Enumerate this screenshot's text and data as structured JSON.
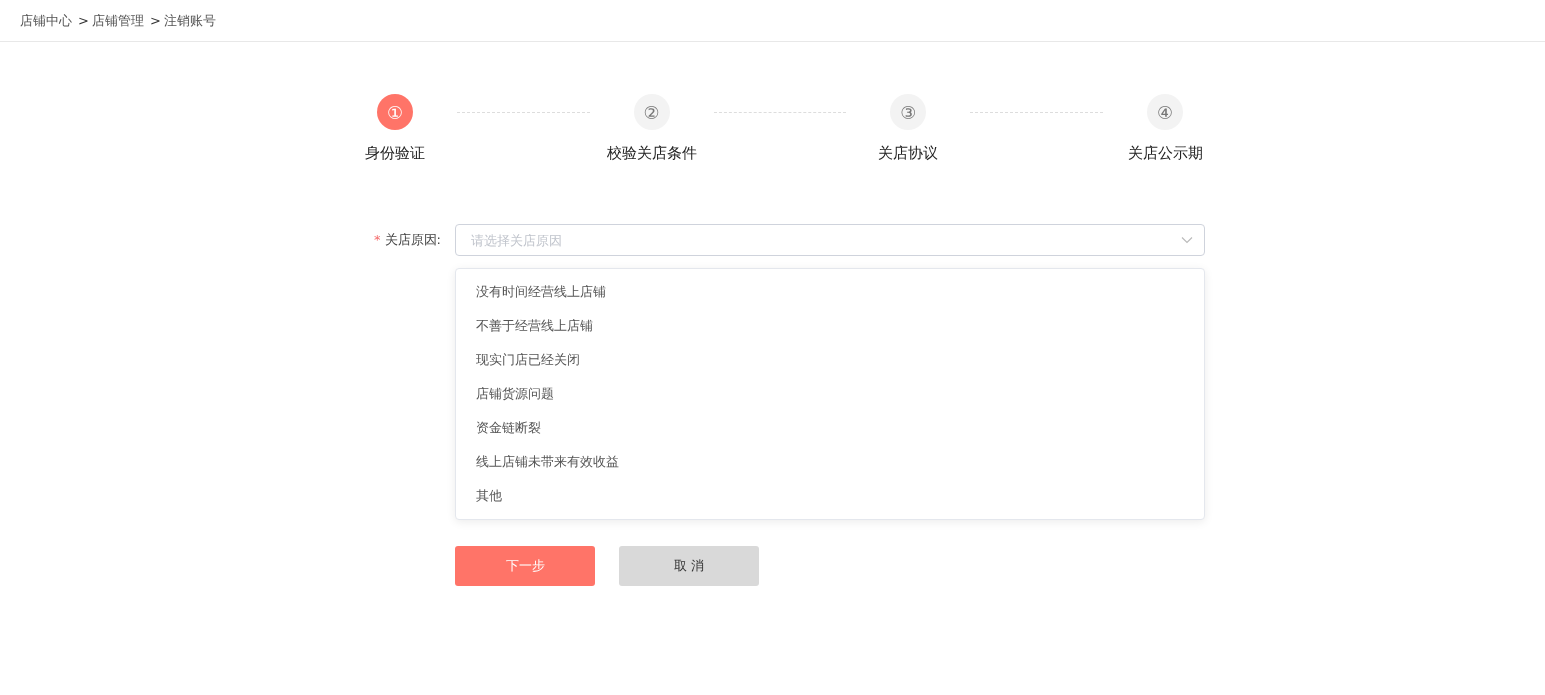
{
  "breadcrumb": [
    {
      "label": "店铺中心"
    },
    {
      "separator": ">",
      "label": "店铺管理"
    },
    {
      "separator": ">",
      "label": "注销账号"
    }
  ],
  "steps": [
    {
      "number": "①",
      "label": "身份验证",
      "selected": true
    },
    {
      "number": "②",
      "label": "校验关店条件",
      "selected": false
    },
    {
      "number": "③",
      "label": "关店协议",
      "selected": false
    },
    {
      "number": "④",
      "label": "关店公示期",
      "selected": false
    }
  ],
  "form": {
    "required_mark": "*",
    "label": "关店原因:",
    "placeholder": "请选择关店原因",
    "expanded": true,
    "options": [
      "没有时间经营线上店铺",
      "不善于经营线上店铺",
      "现实门店已经关闭",
      "店铺货源问题",
      "资金链断裂",
      "线上店铺未带来有效收益",
      "其他"
    ]
  },
  "buttons": [
    {
      "kind": "primary",
      "label": "下一步"
    },
    {
      "kind": "secondary",
      "label": "取 消"
    }
  ]
}
